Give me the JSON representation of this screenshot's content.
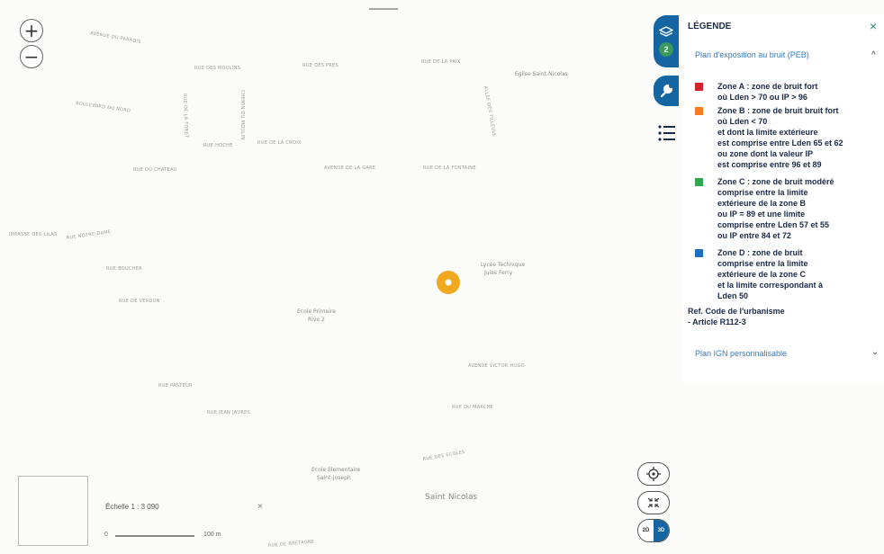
{
  "map": {
    "streets": [
      {
        "text": "AVENUE DU PARADIS"
      },
      {
        "text": "RUE DES MOULINS"
      },
      {
        "text": "RUE DES PRES"
      },
      {
        "text": "RUE DE LA PAIX"
      },
      {
        "text": "BOULEVARD DU NORD"
      },
      {
        "text": "ALLEE DES TILLEULS"
      },
      {
        "text": "RUE DE LA FORET"
      },
      {
        "text": "CHEMIN DU MOULIN"
      },
      {
        "text": "RUE DU CHATEAU"
      },
      {
        "text": "AVENUE DE LA GARE"
      },
      {
        "text": "RUE HOCHE"
      },
      {
        "text": "RUE DE LA CROIX"
      },
      {
        "text": "RUE DE LA FONTAINE"
      },
      {
        "text": "IMPASSE DES LILAS"
      },
      {
        "text": "RUE NOTRE-DAME"
      },
      {
        "text": "RUE BOUCHER"
      },
      {
        "text": "RUE DE VERDUN"
      },
      {
        "text": "AVENUE VICTOR HUGO"
      },
      {
        "text": "RUE PASTEUR"
      },
      {
        "text": "RUE JEAN JAURES"
      },
      {
        "text": "RUE DU MARCHE"
      },
      {
        "text": "RUE DES ECOLES"
      },
      {
        "text": "RUE DE BRETAGNE"
      }
    ],
    "places": {
      "church": "Eglise Saint-Nicolas",
      "school_tech": "Lycée Technique",
      "school_tech_2": "Jules Ferry",
      "school_primary": "Ecole Primaire",
      "school_primary_2": "Rive 2",
      "school_elem": "Ecole Elementaire",
      "school_elem_2": "Saint-Joseph",
      "saint_nicolas": "Saint Nicolas"
    },
    "marker_color": "#f0a81e"
  },
  "controls": {
    "zoom_in": "+",
    "zoom_out": "−",
    "scale_label": "Échelle 1 : 3 090",
    "scale_close": "×",
    "scale_zero": "0",
    "scale_end": "100 m",
    "view_2d": "2D",
    "view_3d": "3D",
    "layers_count": "2"
  },
  "legend": {
    "title": "LÉGENDE",
    "close": "×",
    "layer1_title": "Plan d'exposition au bruit (PEB)",
    "layer1_chevron": "^",
    "zones": [
      {
        "color": "#d2232a",
        "text": "Zone A : zone de bruit fort\noù Lden > 70 ou IP > 96"
      },
      {
        "color": "#f47b20",
        "text": "Zone B : zone de bruit bruit fort\noù Lden < 70\net dont la limite extérieure\nest comprise entre Lden 65 et 62\nou zone dont la valeur IP\nest comprise entre 96 et 89"
      },
      {
        "color": "#2fa84f",
        "text": "Zone C : zone de bruit modéré\ncomprise entre la limite\nextérieure de la zone B\nou IP = 89 et une limite\ncomprise entre Lden 57 et 55\nou IP entre 84 et 72"
      },
      {
        "color": "#1d6fc4",
        "text": "Zone D : zone de bruit\ncomprise entre la limite\nextérieure de la zone C\net la limite correspondant à\nLden 50"
      }
    ],
    "ref": "Ref. Code de l'urbanisme\n- Article R112-3",
    "layer2_title": "Plan IGN personnalisable",
    "layer2_chevron": "⌄"
  },
  "colors": {
    "tab_blue": "#1565a3",
    "badge_green": "#3a9a5a",
    "legend_title": "#1b2a4a",
    "link_blue": "#3a78b8"
  }
}
